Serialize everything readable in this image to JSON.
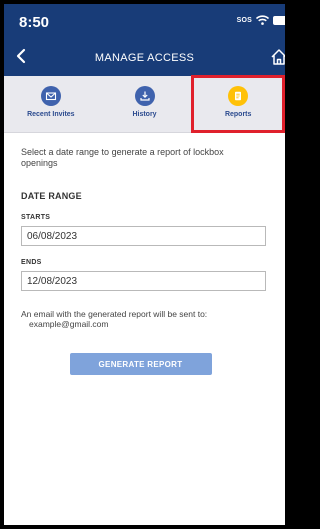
{
  "status_bar": {
    "time": "8:50",
    "sos": "SOS"
  },
  "header": {
    "title": "MANAGE ACCESS"
  },
  "tabs": [
    {
      "label": "Recent Invites",
      "icon": "envelope-icon",
      "active": false
    },
    {
      "label": "History",
      "icon": "download-icon",
      "active": false
    },
    {
      "label": "Reports",
      "icon": "document-icon",
      "active": true
    }
  ],
  "content": {
    "intro": "Select a date range to generate a report of lockbox openings",
    "section_title": "DATE RANGE",
    "starts_label": "STARTS",
    "starts_value": "06/08/2023",
    "ends_label": "ENDS",
    "ends_value": "12/08/2023",
    "email_note": "An email with the generated report will be sent to:",
    "email": "example@gmail.com",
    "generate_button": "GENERATE REPORT"
  },
  "colors": {
    "header_bg": "#183c78",
    "tab_icon": "#3f62ad",
    "active_tab_icon": "#ffc107",
    "highlight": "#e0202c",
    "button": "#7fa3db"
  }
}
